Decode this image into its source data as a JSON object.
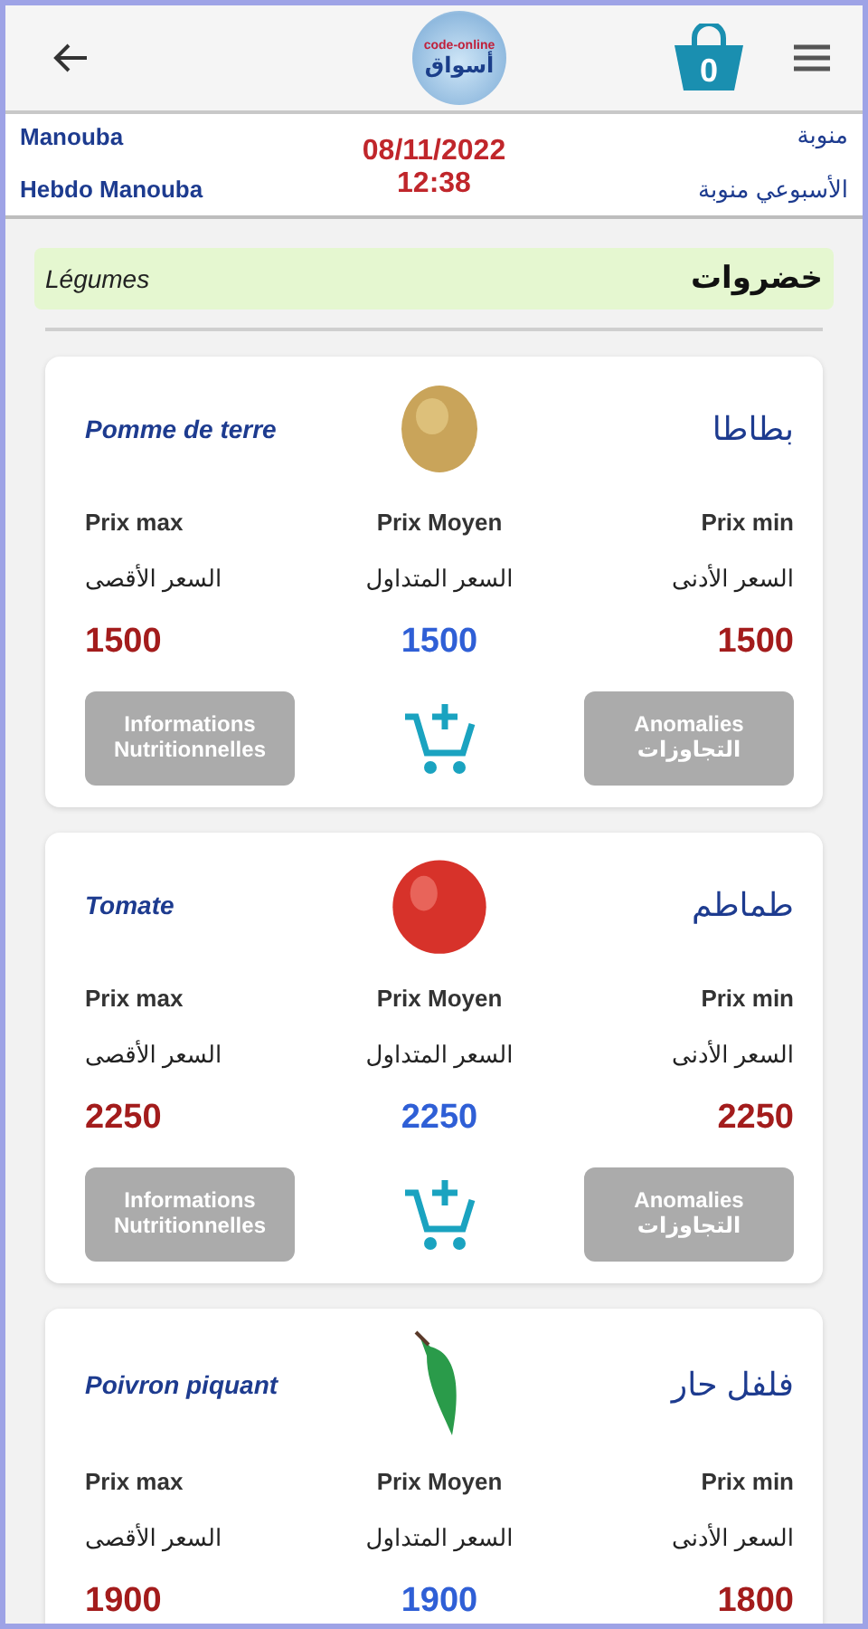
{
  "header": {
    "logo_arc": "code-online",
    "logo_text": "أسواق",
    "cart_count": "0"
  },
  "market": {
    "name_fr": "Manouba",
    "type_fr": "Hebdo Manouba",
    "date": "08/11/2022",
    "time": "12:38",
    "name_ar": "منوبة",
    "type_ar": "الأسبوعي منوبة"
  },
  "category": {
    "name_fr": "Légumes",
    "name_ar": "خضروات"
  },
  "products": [
    {
      "kind": "potato",
      "name_fr": "Pomme de terre",
      "name_ar": "بطاطا",
      "max_fr": "Prix max",
      "avg_fr": "Prix Moyen",
      "min_fr": "Prix min",
      "max_ar": "السعر الأقصى",
      "avg_ar": "السعر المتداول",
      "min_ar": "السعر الأدنى",
      "max": "1500",
      "avg": "1500",
      "min": "1500",
      "info_button": {
        "line1": "Informations",
        "line2": "Nutritionnelles"
      },
      "anomalies_button": {
        "line1": "Anomalies",
        "line2": "التجاوزات"
      }
    },
    {
      "kind": "tomato",
      "name_fr": "Tomate",
      "name_ar": "طماطم",
      "max_fr": "Prix max",
      "avg_fr": "Prix Moyen",
      "min_fr": "Prix min",
      "max_ar": "السعر الأقصى",
      "avg_ar": "السعر المتداول",
      "min_ar": "السعر الأدنى",
      "max": "2250",
      "avg": "2250",
      "min": "2250",
      "info_button": {
        "line1": "Informations",
        "line2": "Nutritionnelles"
      },
      "anomalies_button": {
        "line1": "Anomalies",
        "line2": "التجاوزات"
      }
    },
    {
      "kind": "pepper",
      "name_fr": "Poivron piquant",
      "name_ar": "فلفل حار",
      "max_fr": "Prix max",
      "avg_fr": "Prix Moyen",
      "min_fr": "Prix min",
      "max_ar": "السعر الأقصى",
      "avg_ar": "السعر المتداول",
      "min_ar": "السعر الأدنى",
      "max": "1900",
      "avg": "1900",
      "min": "1800"
    }
  ]
}
